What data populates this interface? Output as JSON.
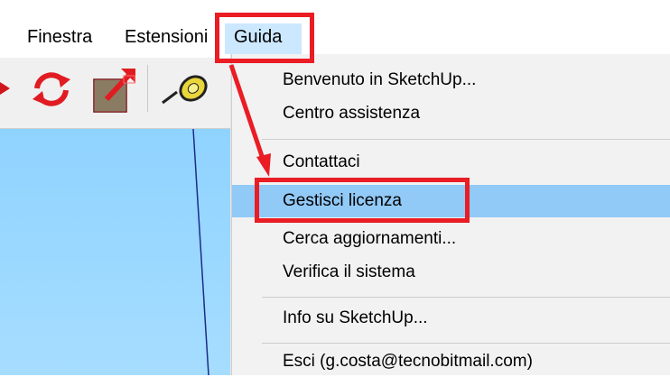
{
  "menubar": {
    "items": [
      {
        "label": "Finestra"
      },
      {
        "label": "Estensioni"
      },
      {
        "label": "Guida"
      }
    ]
  },
  "toolbar": {
    "tools": [
      "rotate-arrow-icon",
      "orbit-icon",
      "scale-icon",
      "tape-measure-icon"
    ]
  },
  "dropdown": {
    "items": [
      {
        "label": "Benvenuto in SketchUp..."
      },
      {
        "label": "Centro assistenza"
      },
      {
        "label": "Contattaci"
      },
      {
        "label": "Gestisci licenza"
      },
      {
        "label": "Cerca aggiornamenti..."
      },
      {
        "label": "Verifica il sistema"
      },
      {
        "label": "Info su SketchUp..."
      },
      {
        "label": "Esci (g.costa@tecnobitmail.com)"
      }
    ],
    "highlighted": "Gestisci licenza"
  },
  "colors": {
    "highlight": "#91c9f7",
    "menu_hover": "#cce8ff",
    "annotation": "#ea1c24",
    "viewport_sky": "#99d8ff"
  }
}
